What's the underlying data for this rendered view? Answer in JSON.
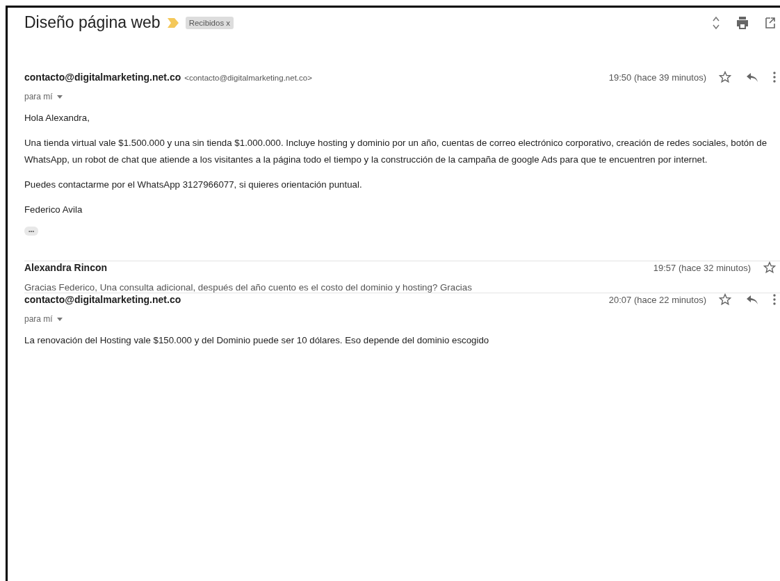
{
  "thread": {
    "subject": "Diseño página web",
    "important": true,
    "labels": [
      {
        "name": "Recibidos",
        "remove": "x"
      }
    ]
  },
  "messages": [
    {
      "kind": "expanded",
      "sender": "contacto@digitalmarketing.net.co",
      "sender_email": "<contacto@digitalmarketing.net.co>",
      "time": "19:50 (hace 39 minutos)",
      "starred": false,
      "recipient": "para mí",
      "body": [
        "Hola Alexandra,",
        "Una tienda virtual vale $1.500.000 y una sin tienda $1.000.000. Incluye hosting y dominio por un año, cuentas de correo electrónico corporativo, creación de redes sociales, botón de WhatsApp, un robot de chat que atiende a los visitantes a la página todo el tiempo y la construcción de la campaña de google Ads para que te encuentren por internet.",
        "Puedes contactarme por el WhatsApp 3127966077, si quieres orientación puntual.",
        "Federico Avila"
      ],
      "trimmed": "•••"
    },
    {
      "kind": "collapsed",
      "sender": "Alexandra Rincon",
      "time": "19:57 (hace 32 minutos)",
      "starred": false,
      "snippet": "Gracias Federico, Una consulta adicional, después del año cuento es el costo del dominio y hosting? Gracias"
    },
    {
      "kind": "expanded",
      "sender": "contacto@digitalmarketing.net.co",
      "time": "20:07 (hace 22 minutos)",
      "starred": false,
      "recipient": "para mí",
      "body": [
        "La renovación del Hosting vale $150.000 y del Dominio puede ser 10 dólares. Eso depende del dominio escogido"
      ]
    }
  ]
}
